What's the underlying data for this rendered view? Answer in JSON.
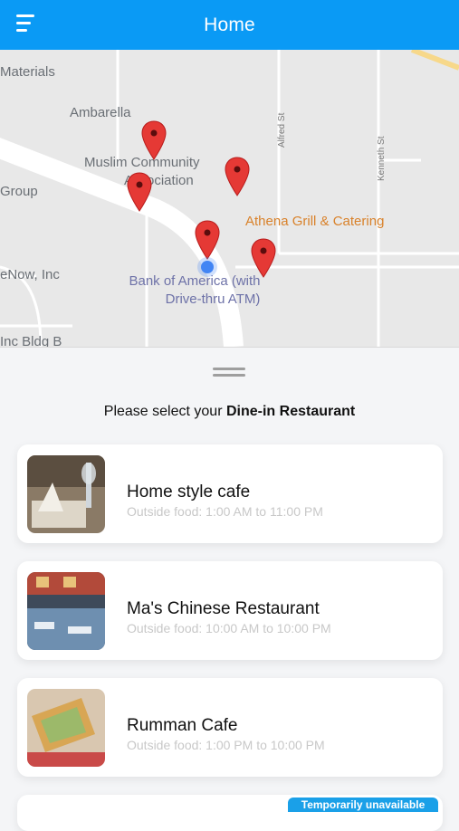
{
  "header": {
    "title": "Home",
    "menu_icon": "hamburger-menu-icon"
  },
  "map": {
    "places": {
      "materials": "Materials",
      "ambarella": "Ambarella",
      "muslim_line1": "Muslim Community",
      "muslim_line2": "Association",
      "group": "Group",
      "enow": "eNow, Inc",
      "athena": "Athena Grill & Catering",
      "bank_line1": "Bank of America (with",
      "bank_line2": "Drive-thru ATM)",
      "bldg": "Inc  Bldg B"
    },
    "streets": {
      "alfred": "Alfred St",
      "kenneth": "Kenneth St"
    },
    "pin_color": "#e53935",
    "location_color": "#4285f4"
  },
  "sheet": {
    "prompt_prefix": "Please select your ",
    "prompt_bold": "Dine-in Restaurant",
    "restaurants": [
      {
        "name": "Home style cafe",
        "hours": "Outside food: 1:00 AM to 11:00 PM"
      },
      {
        "name": "Ma's Chinese Restaurant",
        "hours": "Outside food: 10:00 AM to 10:00 PM"
      },
      {
        "name": "Rumman Cafe",
        "hours": "Outside food: 1:00 PM to 10:00 PM"
      }
    ],
    "partial_badge": "Temporarily unavailable"
  },
  "colors": {
    "accent": "#0a9af5",
    "badge": "#1aa0e8"
  }
}
